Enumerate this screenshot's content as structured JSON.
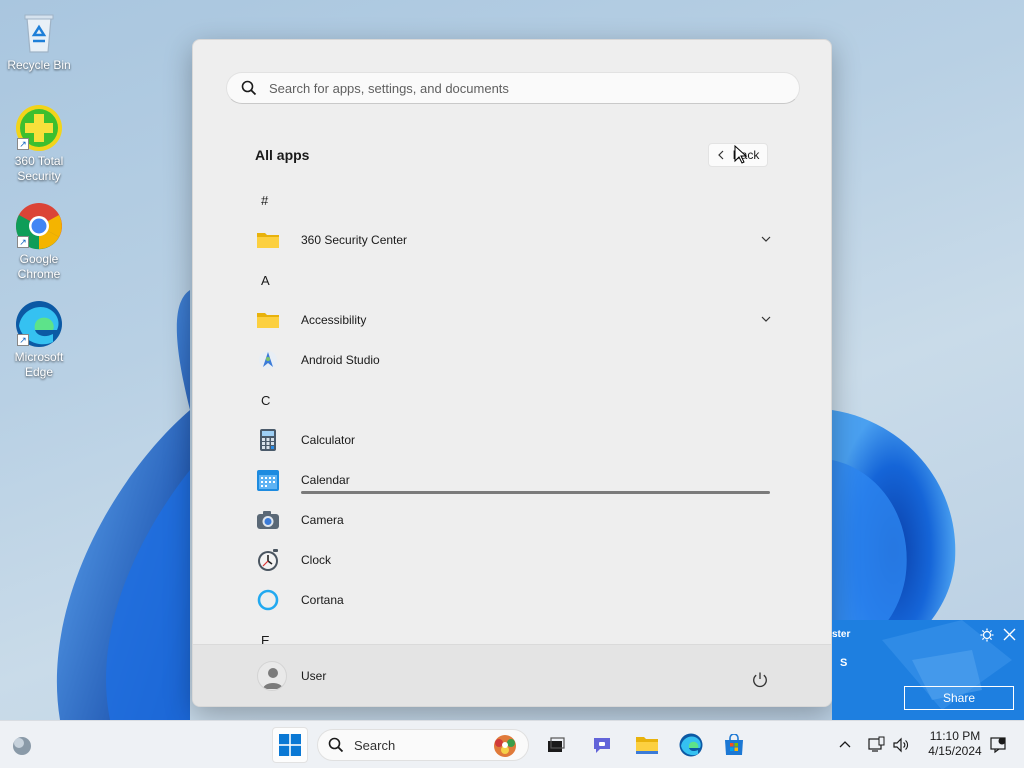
{
  "desktop": {
    "icons": [
      {
        "label": "Recycle Bin"
      },
      {
        "label": "360 Total Security"
      },
      {
        "label": "Google Chrome"
      },
      {
        "label": "Microsoft Edge"
      }
    ]
  },
  "start_menu": {
    "search_placeholder": "Search for apps, settings, and documents",
    "all_apps_title": "All apps",
    "back_label": "Back",
    "groups": [
      {
        "letter": "#"
      },
      {
        "app": "360 Security Center",
        "expandable": true,
        "icon": "folder-icon"
      },
      {
        "letter": "A"
      },
      {
        "app": "Accessibility",
        "expandable": true,
        "icon": "folder-icon"
      },
      {
        "app": "Android Studio",
        "icon": "android-studio-icon"
      },
      {
        "letter": "C"
      },
      {
        "app": "Calculator",
        "icon": "calculator-icon"
      },
      {
        "app": "Calendar",
        "icon": "calendar-icon"
      },
      {
        "app": "Camera",
        "icon": "camera-icon"
      },
      {
        "app": "Clock",
        "icon": "clock-icon"
      },
      {
        "app": "Cortana",
        "icon": "cortana-icon"
      },
      {
        "letter": "E"
      }
    ],
    "user_name": "User"
  },
  "toast": {
    "title": "ster",
    "subtitle": "S",
    "share_label": "Share"
  },
  "taskbar": {
    "search_label": "Search",
    "time": "11:10 PM",
    "date": "4/15/2024"
  },
  "colors": {
    "accent": "#0067c0",
    "toast_bg": "#1e7fe0"
  }
}
